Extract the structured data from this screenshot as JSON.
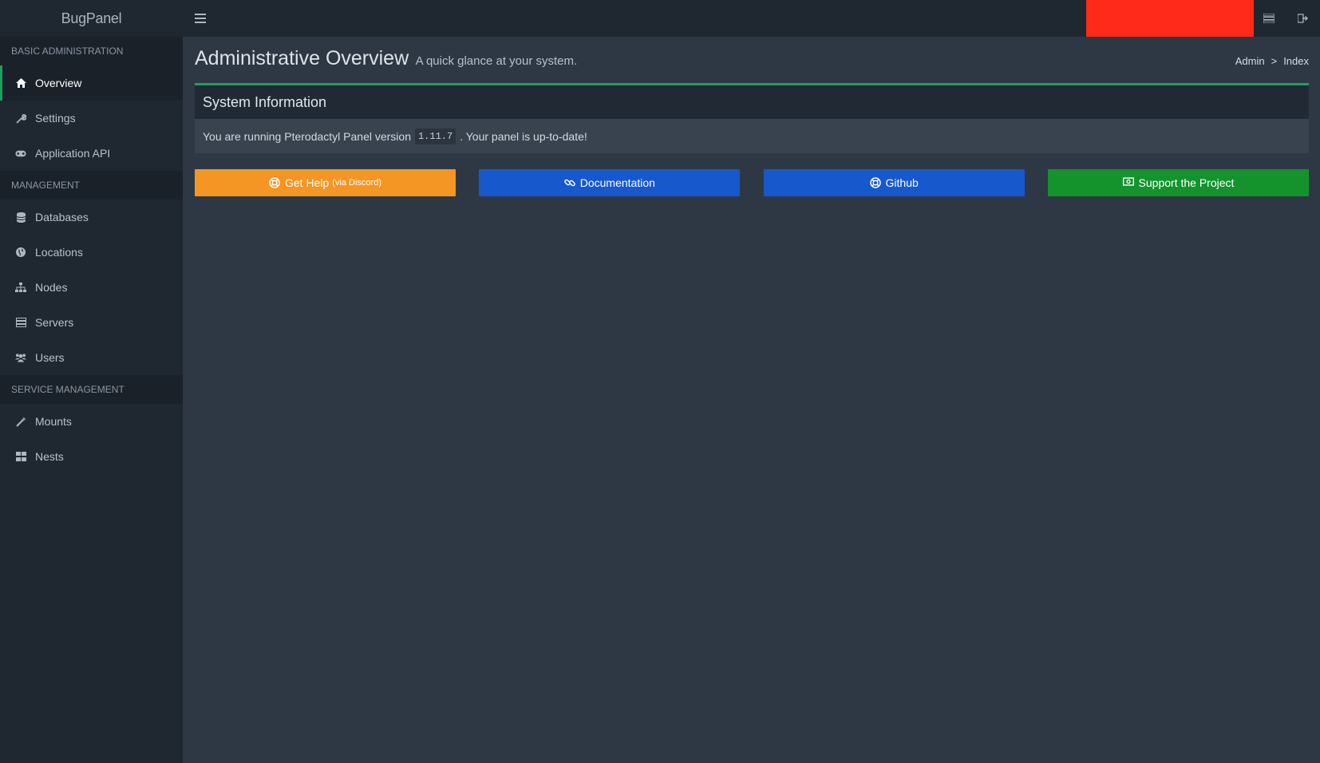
{
  "app": {
    "brand": "BugPanel"
  },
  "topbar": {
    "menu_icon": "hamburger-icon",
    "servers_icon": "server-list-icon",
    "logout_icon": "sign-out-icon",
    "accent_block_color": "#ff2a1a"
  },
  "sidebar": {
    "sections": [
      {
        "title": "BASIC ADMINISTRATION",
        "items": [
          {
            "label": "Overview",
            "icon": "home-icon",
            "active": true
          },
          {
            "label": "Settings",
            "icon": "wrench-icon"
          },
          {
            "label": "Application API",
            "icon": "gamepad-icon"
          }
        ]
      },
      {
        "title": "MANAGEMENT",
        "items": [
          {
            "label": "Databases",
            "icon": "database-icon"
          },
          {
            "label": "Locations",
            "icon": "globe-icon"
          },
          {
            "label": "Nodes",
            "icon": "sitemap-icon"
          },
          {
            "label": "Servers",
            "icon": "server-icon"
          },
          {
            "label": "Users",
            "icon": "users-icon"
          }
        ]
      },
      {
        "title": "SERVICE MANAGEMENT",
        "items": [
          {
            "label": "Mounts",
            "icon": "magic-icon"
          },
          {
            "label": "Nests",
            "icon": "th-large-icon"
          }
        ]
      }
    ]
  },
  "page": {
    "title": "Administrative Overview",
    "subtitle": "A quick glance at your system.",
    "breadcrumb": {
      "admin": "Admin",
      "separator": ">",
      "current": "Index"
    }
  },
  "system_info": {
    "title": "System Information",
    "text_before": "You are running Pterodactyl Panel version",
    "version": "1.11.7",
    "text_after": ". Your panel is up-to-date!"
  },
  "buttons": {
    "help": {
      "label": "Get Help",
      "note": "(via Discord)",
      "icon": "life-ring-icon"
    },
    "docs": {
      "label": "Documentation",
      "icon": "link-icon"
    },
    "github": {
      "label": "Github",
      "icon": "life-ring-icon"
    },
    "support": {
      "label": "Support the Project",
      "icon": "money-icon"
    }
  },
  "colors": {
    "active_accent": "#1f9e62",
    "orange": "#f39623",
    "blue": "#1758cc",
    "green": "#14932d"
  }
}
